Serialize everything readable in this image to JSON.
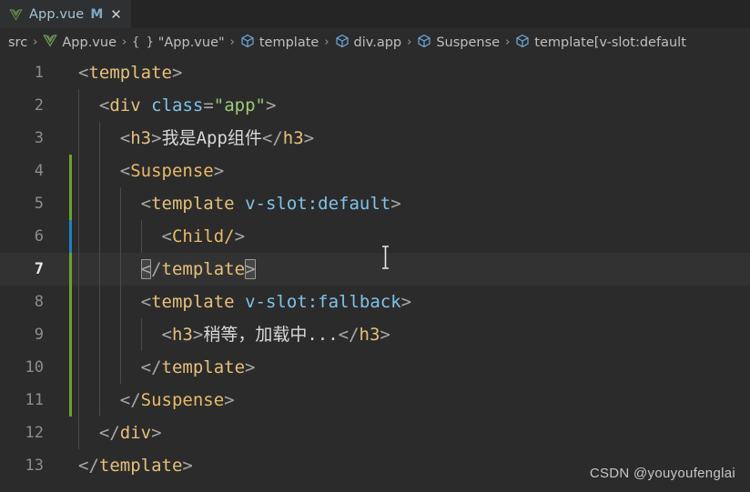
{
  "window": {
    "theme_background": "#2b2b2b",
    "editor_background": "#2b2b2b",
    "active_line_background": "#323232"
  },
  "tab_bar": {
    "tabs": [
      {
        "icon": "vue-logo-icon",
        "label": "App.vue",
        "dirty_marker": "M",
        "close_icon": "✕"
      }
    ]
  },
  "breadcrumb": {
    "items": [
      {
        "icon": "none",
        "label": "src"
      },
      {
        "icon": "vue-logo-icon",
        "label": "App.vue"
      },
      {
        "icon": "braces-icon",
        "icon_text": "{ }",
        "label": "\"App.vue\""
      },
      {
        "icon": "symbol-cube-icon",
        "label": "template"
      },
      {
        "icon": "symbol-cube-icon",
        "label": "div.app"
      },
      {
        "icon": "symbol-cube-icon",
        "label": "Suspense"
      },
      {
        "icon": "symbol-cube-icon",
        "label": "template[v-slot:default"
      }
    ],
    "separator": "›"
  },
  "editor": {
    "active_line": 7,
    "modified_gutter_lines": [
      4,
      5,
      6,
      7,
      8,
      9,
      10,
      11
    ],
    "cursor_gutter_line": 6,
    "line_numbers": [
      1,
      2,
      3,
      4,
      5,
      6,
      7,
      8,
      9,
      10,
      11,
      12,
      13
    ],
    "lines": [
      {
        "n": 1,
        "text": "<template>"
      },
      {
        "n": 2,
        "text": "  <div class=\"app\">"
      },
      {
        "n": 3,
        "text": "    <h3>我是App组件</h3>"
      },
      {
        "n": 4,
        "text": "    <Suspense>"
      },
      {
        "n": 5,
        "text": "      <template v-slot:default>"
      },
      {
        "n": 6,
        "text": "        <Child/>"
      },
      {
        "n": 7,
        "text": "      </template>"
      },
      {
        "n": 8,
        "text": "      <template v-slot:fallback>"
      },
      {
        "n": 9,
        "text": "        <h3>稍等，加载中...</h3>"
      },
      {
        "n": 10,
        "text": "      </template>"
      },
      {
        "n": 11,
        "text": "    </Suspense>"
      },
      {
        "n": 12,
        "text": "  </div>"
      },
      {
        "n": 13,
        "text": "</template>"
      }
    ],
    "syntax_colors": {
      "punctuation": "#a8a8a8",
      "tag_name": "#e5c07b",
      "attribute": "#7fc3e8",
      "attribute_value": "#9fc97b",
      "plain_text": "#d8d8d8",
      "gutter_modified": "#68a328",
      "gutter_cursor": "#1b81c4"
    }
  },
  "watermark": {
    "text": "CSDN @youyoufenglai"
  }
}
